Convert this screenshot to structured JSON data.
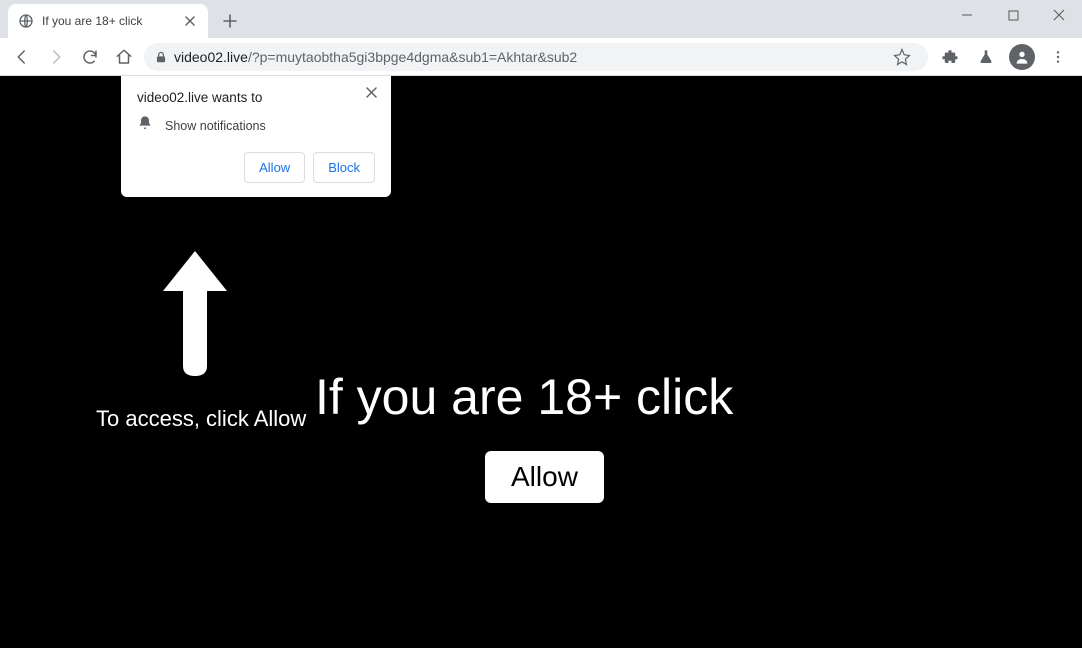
{
  "window": {
    "tab_title": "If you are 18+ click"
  },
  "address_bar": {
    "domain": "video02.live",
    "path": "/?p=muytaobtha5gi3bpge4dgma&sub1=Akhtar&sub2"
  },
  "notification_prompt": {
    "origin_line": "video02.live wants to",
    "message": "Show notifications",
    "allow_label": "Allow",
    "block_label": "Block"
  },
  "page": {
    "access_label": "To access, click Allow",
    "headline": "If you are 18+ click",
    "allow_button_label": "Allow"
  }
}
